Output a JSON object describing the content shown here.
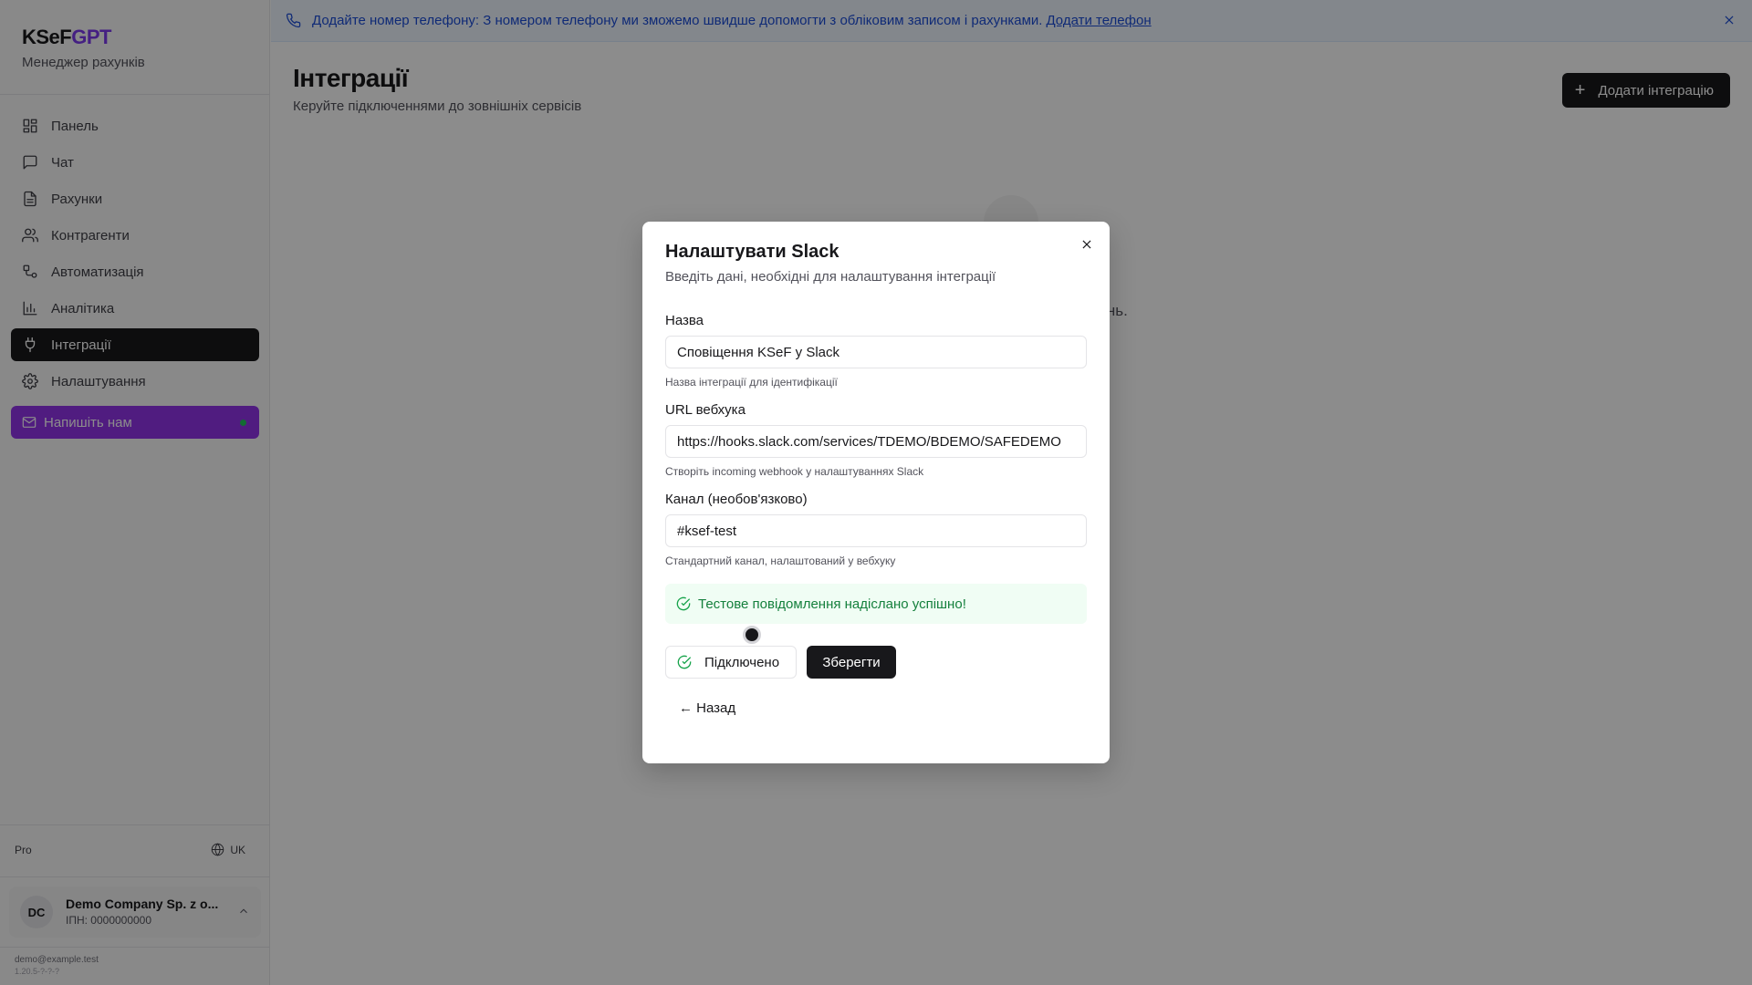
{
  "sidebar": {
    "brand": {
      "main": "KSeF",
      "accent": "GPT"
    },
    "subtitle": "Менеджер рахунків",
    "nav": [
      {
        "label": "Панель",
        "icon": "dashboard-icon"
      },
      {
        "label": "Чат",
        "icon": "chat-icon"
      },
      {
        "label": "Рахунки",
        "icon": "invoice-icon"
      },
      {
        "label": "Контрагенти",
        "icon": "users-icon"
      },
      {
        "label": "Автоматизація",
        "icon": "workflow-icon"
      },
      {
        "label": "Аналітика",
        "icon": "chart-icon"
      },
      {
        "label": "Інтеграції",
        "icon": "plug-icon",
        "active": true
      },
      {
        "label": "Налаштування",
        "icon": "gear-icon"
      }
    ],
    "contact_label": "Напишіть нам",
    "plan": "Pro",
    "language": "UK",
    "company": {
      "initials": "DC",
      "name": "Demo Company Sp. z o...",
      "nip": "ІПН: 0000000000"
    },
    "email": "demo@example.test",
    "version": "1.20.5-?-?-?"
  },
  "banner": {
    "text": "Додайте номер телефону: З номером телефону ми зможемо швидше допомогти з обліковим записом і рахунками.",
    "link": "Додати телефон"
  },
  "main": {
    "title": "Інтеграції",
    "subtitle": "Керуйте підключеннями до зовнішніх сервісів",
    "add_button": "Додати інтеграцію",
    "empty_text": "ки сповіщень."
  },
  "modal": {
    "title": "Налаштувати Slack",
    "description": "Введіть дані, необхідні для налаштування інтеграції",
    "fields": {
      "name": {
        "label": "Назва",
        "value": "Сповіщення KSeF у Slack",
        "hint": "Назва інтеграції для ідентифікації"
      },
      "webhook": {
        "label": "URL вебхука",
        "value": "https://hooks.slack.com/services/TDEMO/BDEMO/SAFEDEMO",
        "hint": "Створіть incoming webhook у налаштуваннях Slack"
      },
      "channel": {
        "label": "Канал (необов'язково)",
        "value": "#ksef-test",
        "hint": "Стандартний канал, налаштований у вебхуку"
      }
    },
    "success_message": "Тестове повідомлення надіслано успішно!",
    "connected_label": "Підключено",
    "save_label": "Зберегти",
    "back_label": "← Назад"
  },
  "colors": {
    "accent": "#7c3aed",
    "contact_button": "#9333ea",
    "primary": "#18181b",
    "success": "#16a34a",
    "banner": "#1d4ed8"
  }
}
